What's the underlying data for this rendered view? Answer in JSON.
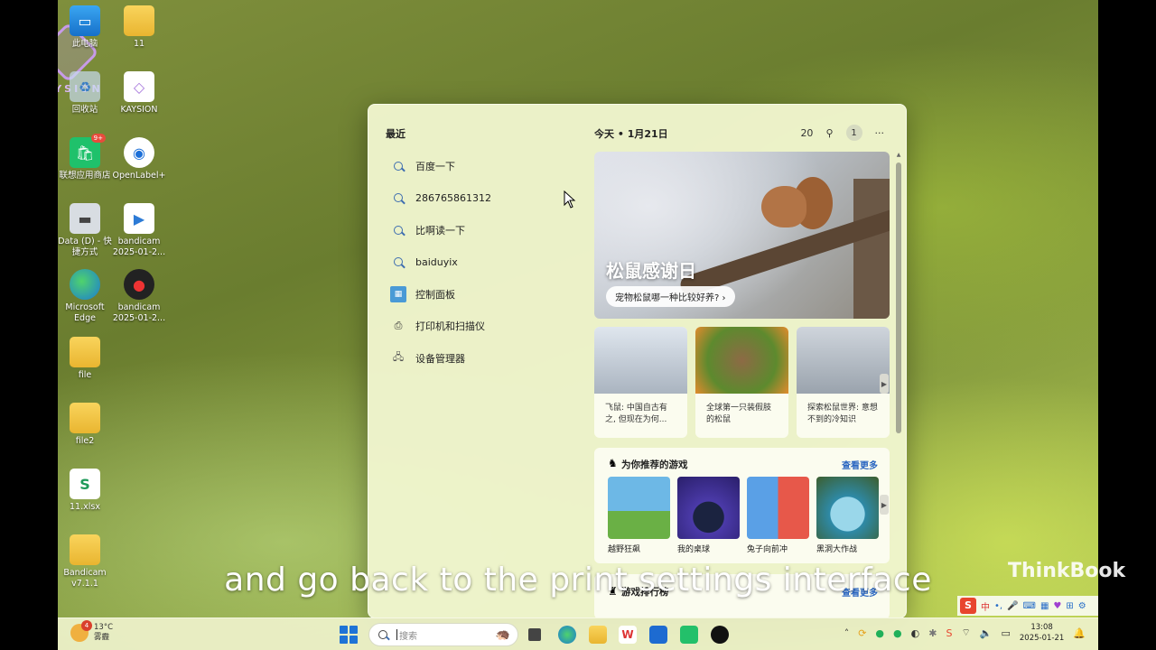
{
  "desktop": {
    "watermark_text": "KAYSION",
    "icons": [
      {
        "label": "此电脑",
        "icon": "computer-icon"
      },
      {
        "label": "11",
        "icon": "folder-icon"
      },
      {
        "label": "回收站",
        "icon": "recycle-bin-icon"
      },
      {
        "label": "KAYSION",
        "icon": "kaysion-icon"
      },
      {
        "label": "联想应用商店",
        "icon": "app-store-icon",
        "badge": "9+"
      },
      {
        "label": "OpenLabel+",
        "icon": "openlabel-icon"
      },
      {
        "label": "Data (D) - 快捷方式",
        "icon": "drive-shortcut-icon"
      },
      {
        "label": "bandicam 2025-01-2...",
        "icon": "video-file-icon"
      },
      {
        "label": "Microsoft Edge",
        "icon": "edge-icon"
      },
      {
        "label": "bandicam 2025-01-2...",
        "icon": "bandicam-icon"
      },
      {
        "label": "file",
        "icon": "folder-icon"
      },
      {
        "label": "file2",
        "icon": "folder-icon"
      },
      {
        "label": "11.xlsx",
        "icon": "spreadsheet-icon"
      },
      {
        "label": "Bandicam v7.1.1",
        "icon": "folder-icon"
      }
    ]
  },
  "panel": {
    "recent_title": "最近",
    "recent": [
      {
        "label": "百度一下",
        "icon": "search-icon"
      },
      {
        "label": "286765861312",
        "icon": "search-icon"
      },
      {
        "label": "比啊读一下",
        "icon": "search-icon"
      },
      {
        "label": "baiduyix",
        "icon": "search-icon"
      },
      {
        "label": "控制面板",
        "icon": "control-panel-icon"
      },
      {
        "label": "打印机和扫描仪",
        "icon": "printer-icon"
      },
      {
        "label": "设备管理器",
        "icon": "device-manager-icon"
      }
    ],
    "today_label": "今天 • 1月21日",
    "points": "20",
    "notification_count": "1",
    "more": "···",
    "hero": {
      "title": "松鼠感谢日",
      "pill": "宠物松鼠哪一种比较好养? ›"
    },
    "cards": [
      {
        "text": "飞鼠: 中国自古有之, 但现在为何...",
        "color": "#c9d3dd"
      },
      {
        "text": "全球第一只装假肢的松鼠",
        "color": "#6f8f3b"
      },
      {
        "text": "探索松鼠世界: 意想不到的冷知识",
        "color": "#b9bfc8"
      }
    ],
    "games": {
      "title": "为你推荐的游戏",
      "more": "查看更多",
      "items": [
        {
          "name": "越野狂飙",
          "color": "#62a8d8"
        },
        {
          "name": "我的桌球",
          "color": "#3d2f8f"
        },
        {
          "name": "兔子向前冲",
          "color": "#6aa6e0"
        },
        {
          "name": "黑洞大作战",
          "color": "#3f9fb5"
        }
      ]
    },
    "ranks": {
      "title": "游戏排行榜",
      "more": "查看更多"
    }
  },
  "subtitle": "and go back to the print settings interface",
  "brand": "ThinkBook",
  "taskbar": {
    "weather_temp": "13°C",
    "weather_desc": "雾霾",
    "weather_badge": "4",
    "search_placeholder": "搜索",
    "time": "13:08",
    "date": "2025-01-21"
  },
  "ime": {
    "logo": "S",
    "lang": "中"
  }
}
